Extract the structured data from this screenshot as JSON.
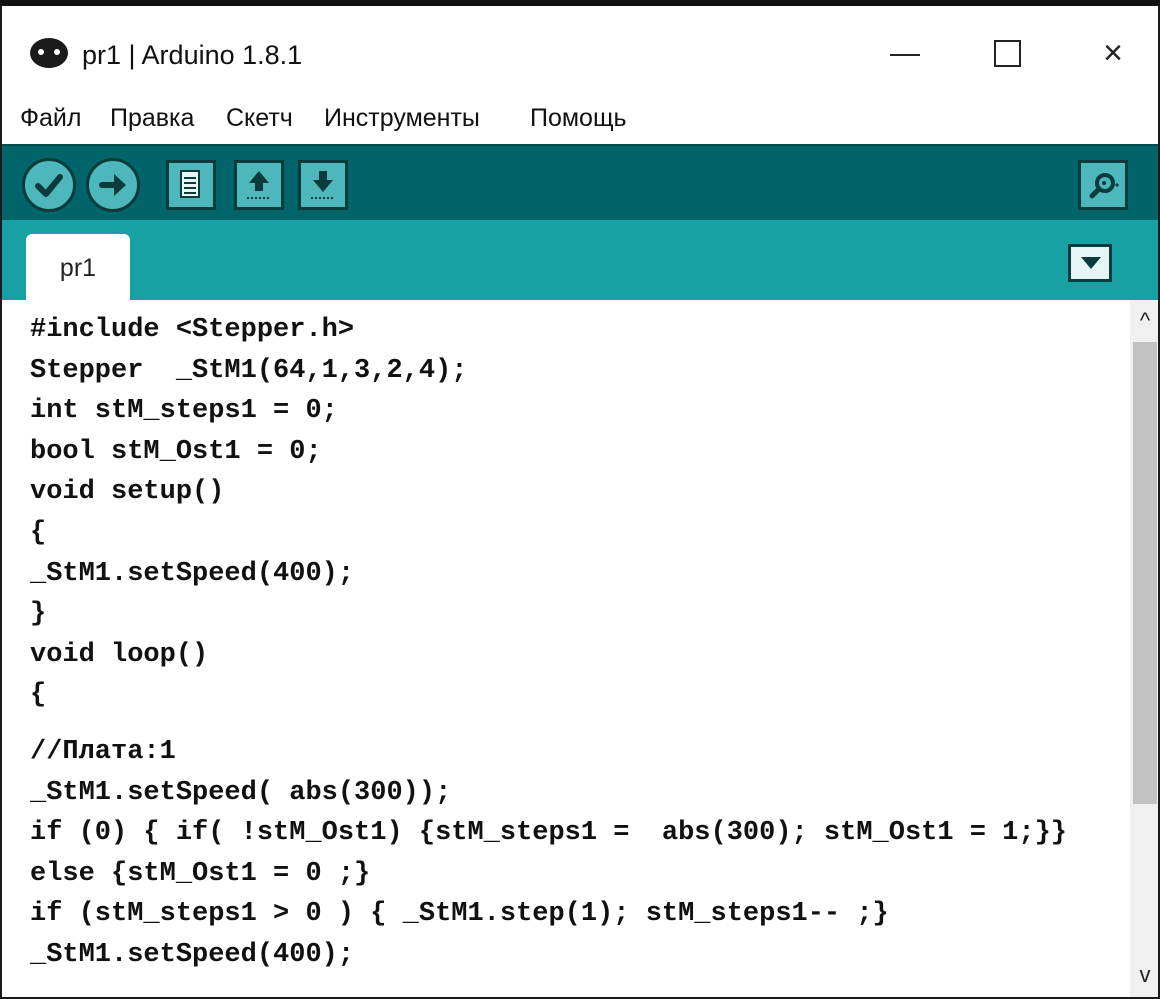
{
  "window": {
    "title": "pr1 | Arduino 1.8.1",
    "close_glyph": "×"
  },
  "menu": {
    "items": [
      "Файл",
      "Правка",
      "Скетч",
      "Инструменты",
      "Помощь"
    ]
  },
  "toolbar": {
    "buttons": [
      "check-icon",
      "upload-arrow-icon",
      "new-sketch-icon",
      "open-icon",
      "save-icon",
      "serial-monitor-icon"
    ]
  },
  "tabs": {
    "active": "pr1"
  },
  "editor": {
    "lines": [
      "#include <Stepper.h>",
      "Stepper  _StM1(64,1,3,2,4);",
      "int stM_steps1 = 0;",
      "bool stM_Ost1 = 0;",
      "void setup()",
      "{",
      "_StM1.setSpeed(400);",
      "}",
      "void loop()",
      "{",
      "//Плата:1",
      "_StM1.setSpeed( abs(300));",
      "if (0) { if( !stM_Ost1) {stM_steps1 =  abs(300); stM_Ost1 = 1;}}",
      "else {stM_Ost1 = 0 ;}",
      "if (stM_steps1 > 0 ) { _StM1.step(1); stM_steps1-- ;}",
      "_StM1.setSpeed(400);"
    ]
  },
  "scrollbar": {
    "up_glyph": "^",
    "down_glyph": "v"
  },
  "colors": {
    "toolbar": "#006468",
    "tabbar": "#17a1a5",
    "button": "#4db7bb"
  }
}
